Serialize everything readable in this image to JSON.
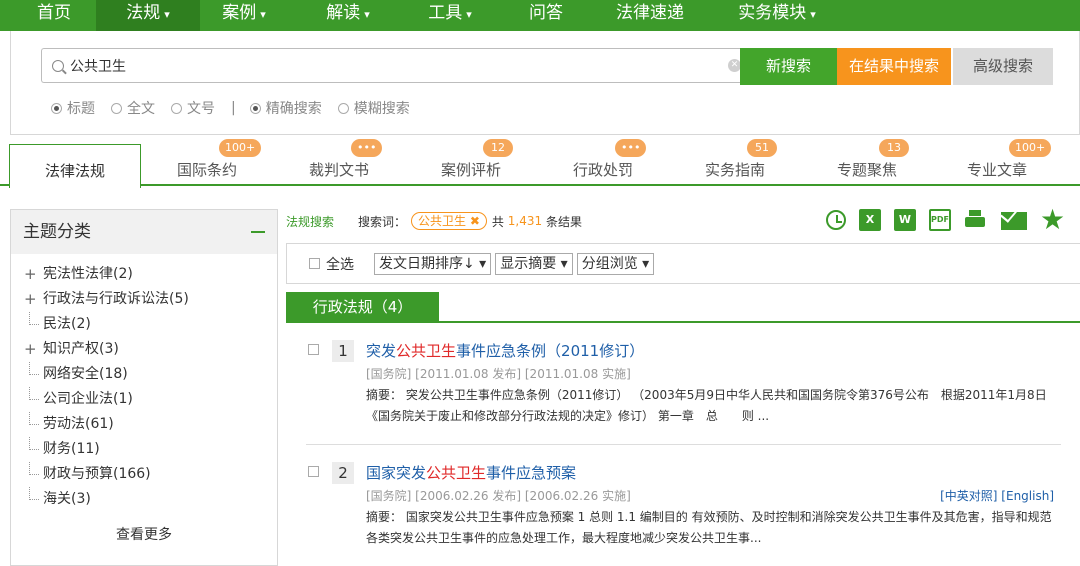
{
  "nav": {
    "items": [
      {
        "label": "首页",
        "dropdown": false,
        "active": false
      },
      {
        "label": "法规",
        "dropdown": true,
        "active": true
      },
      {
        "label": "案例",
        "dropdown": true,
        "active": false
      },
      {
        "label": "解读",
        "dropdown": true,
        "active": false
      },
      {
        "label": "工具",
        "dropdown": true,
        "active": false
      },
      {
        "label": "问答",
        "dropdown": false,
        "active": false
      },
      {
        "label": "法律速递",
        "dropdown": false,
        "active": false
      },
      {
        "label": "实务模块",
        "dropdown": true,
        "active": false
      }
    ],
    "caret": "▾",
    "color": "#3c9a2a"
  },
  "search": {
    "value": "公共卫生",
    "btn_new": "新搜索",
    "btn_in_results": "在结果中搜索",
    "btn_advanced": "高级搜索",
    "scope_options": [
      "标题",
      "全文",
      "文号"
    ],
    "scope_selected": "标题",
    "mode_options": [
      "精确搜索",
      "模糊搜索"
    ],
    "mode_selected": "精确搜索",
    "separator": "|"
  },
  "tabs": [
    {
      "label": "法律法规",
      "badge": "",
      "active": true
    },
    {
      "label": "国际条约",
      "badge": "100+",
      "active": false
    },
    {
      "label": "裁判文书",
      "badge": "•••",
      "active": false
    },
    {
      "label": "案例评析",
      "badge": "12",
      "active": false
    },
    {
      "label": "行政处罚",
      "badge": "•••",
      "active": false
    },
    {
      "label": "实务指南",
      "badge": "51",
      "active": false
    },
    {
      "label": "专题聚焦",
      "badge": "13",
      "active": false
    },
    {
      "label": "专业文章",
      "badge": "100+",
      "active": false
    }
  ],
  "sidebar": {
    "title": "主题分类",
    "categories": [
      {
        "label": "宪法性法律(2)",
        "expandable": true
      },
      {
        "label": "行政法与行政诉讼法(5)",
        "expandable": true
      },
      {
        "label": "民法(2)",
        "expandable": false
      },
      {
        "label": "知识产权(3)",
        "expandable": true
      },
      {
        "label": "网络安全(18)",
        "expandable": false
      },
      {
        "label": "公司企业法(1)",
        "expandable": false
      },
      {
        "label": "劳动法(61)",
        "expandable": false
      },
      {
        "label": "财务(11)",
        "expandable": false
      },
      {
        "label": "财政与预算(166)",
        "expandable": false
      },
      {
        "label": "海关(3)",
        "expandable": false
      }
    ],
    "more": "查看更多"
  },
  "results_bar": {
    "crumb": "法规搜索",
    "kw_label": "搜索词：",
    "kw": "公共卫生 ✖",
    "total_prefix": "共",
    "total": "1,431",
    "total_suffix": "条结果",
    "icons": [
      "alarm-clock-icon",
      "excel-icon",
      "word-icon",
      "pdf-icon",
      "print-icon",
      "mail-icon",
      "star-icon"
    ]
  },
  "options": {
    "select_all": "全选",
    "sort": "发文日期排序↓ ▾",
    "summary": "显示摘要 ▾",
    "group": "分组浏览 ▾"
  },
  "section": {
    "title": "行政法规（4）"
  },
  "results": [
    {
      "num": "1",
      "title_pre": "突发",
      "title_hl": "公共卫生",
      "title_post": "事件应急条例（2011修订）",
      "meta": "[国务院] [2011.01.08 发布] [2011.01.08 实施]",
      "links": "",
      "abstract": "摘要： 突发公共卫生事件应急条例（2011修订） （2003年5月9日中华人民共和国国务院令第376号公布　根据2011年1月8日《国务院关于废止和修改部分行政法规的决定》修订） 第一章　总　　则 ..."
    },
    {
      "num": "2",
      "title_pre": "国家突发",
      "title_hl": "公共卫生",
      "title_post": "事件应急预案",
      "meta": "[国务院] [2006.02.26 发布] [2006.02.26 实施]",
      "links": "[中英对照] [English]",
      "abstract": "摘要： 国家突发公共卫生事件应急预案 1 总则 1.1 编制目的 有效预防、及时控制和消除突发公共卫生事件及其危害，指导和规范各类突发公共卫生事件的应急处理工作，最大程度地减少突发公共卫生事..."
    }
  ]
}
